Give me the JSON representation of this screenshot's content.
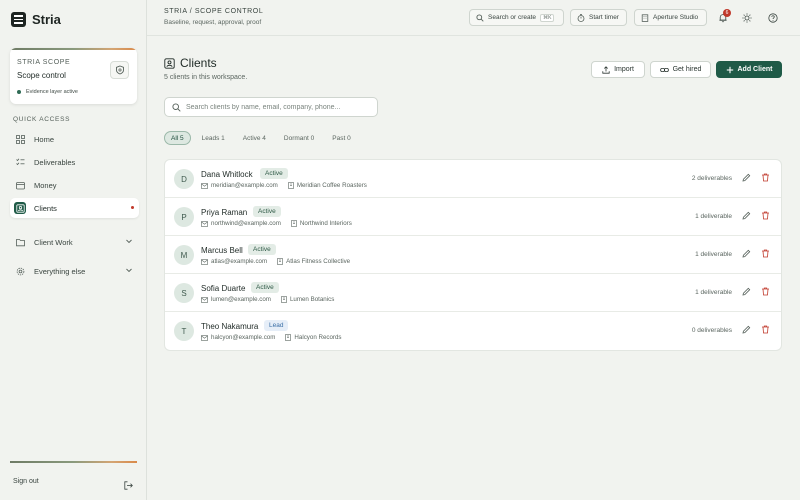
{
  "app": {
    "name": "Stria"
  },
  "scope_card": {
    "kicker": "STRIA SCOPE",
    "title": "Scope control",
    "status": "Evidence layer active"
  },
  "sidebar": {
    "section_label": "QUICK ACCESS",
    "items": [
      {
        "label": "Home",
        "icon": "grid-icon"
      },
      {
        "label": "Deliverables",
        "icon": "checklist-icon"
      },
      {
        "label": "Money",
        "icon": "wallet-icon"
      },
      {
        "label": "Clients",
        "icon": "user-card-icon",
        "active": true
      }
    ],
    "groups": [
      {
        "label": "Client Work",
        "icon": "folder-icon"
      },
      {
        "label": "Everything else",
        "icon": "gear-icon"
      }
    ],
    "sign_out": "Sign out"
  },
  "topbar": {
    "breadcrumb": "STRIA / SCOPE CONTROL",
    "subtitle": "Baseline, request, approval, proof",
    "search_label": "Search or create",
    "search_shortcut": "⌘K",
    "timer_label": "Start timer",
    "workspace_label": "Aperture Studio",
    "notification_count": "6"
  },
  "page": {
    "title": "Clients",
    "subtitle": "5 clients in this workspace.",
    "import_label": "Import",
    "get_hired_label": "Get hired",
    "add_client_label": "Add Client",
    "search_placeholder": "Search clients by name, email, company, phone..."
  },
  "filters": [
    {
      "label": "All 5",
      "active": true
    },
    {
      "label": "Leads 1"
    },
    {
      "label": "Active 4"
    },
    {
      "label": "Dormant 0"
    },
    {
      "label": "Past 0"
    }
  ],
  "clients": [
    {
      "initial": "D",
      "name": "Dana Whitlock",
      "status": "Active",
      "email": "meridian@example.com",
      "company": "Meridian Coffee Roasters",
      "deliverables": "2 deliverables"
    },
    {
      "initial": "P",
      "name": "Priya Raman",
      "status": "Active",
      "email": "northwind@example.com",
      "company": "Northwind Interiors",
      "deliverables": "1 deliverable"
    },
    {
      "initial": "M",
      "name": "Marcus Bell",
      "status": "Active",
      "email": "atlas@example.com",
      "company": "Atlas Fitness Collective",
      "deliverables": "1 deliverable"
    },
    {
      "initial": "S",
      "name": "Sofia Duarte",
      "status": "Active",
      "email": "lumen@example.com",
      "company": "Lumen Botanics",
      "deliverables": "1 deliverable"
    },
    {
      "initial": "T",
      "name": "Theo Nakamura",
      "status": "Lead",
      "email": "halcyon@example.com",
      "company": "Halcyon Records",
      "deliverables": "0 deliverables"
    }
  ],
  "colors": {
    "primary": "#1f5a47",
    "background": "#f1f3ef",
    "alert": "#c0392b",
    "lead_badge": "#3b6fa6"
  }
}
